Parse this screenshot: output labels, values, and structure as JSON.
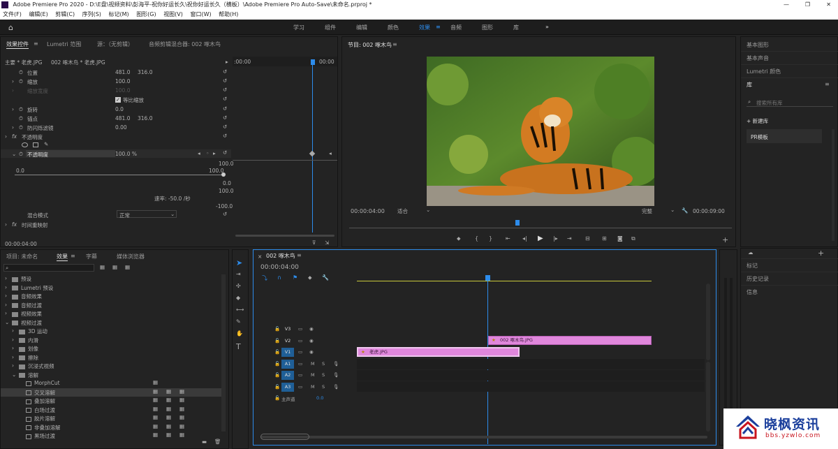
{
  "window": {
    "title": "Adobe Premiere Pro 2020 - D:\\E盘\\视频资料\\彭海平-祝你好运长久\\祝你好运长久（横板）\\Adobe Premiere Pro Auto-Save\\未命名.prproj *"
  },
  "menu": [
    "文件(F)",
    "编辑(E)",
    "剪辑(C)",
    "序列(S)",
    "标记(M)",
    "图形(G)",
    "视图(V)",
    "窗口(W)",
    "帮助(H)"
  ],
  "workspaces": [
    "学习",
    "组件",
    "编辑",
    "颜色",
    "效果",
    "音频",
    "图形",
    "库"
  ],
  "workspace_active": "效果",
  "effect_controls": {
    "tabs": [
      "效果控件",
      "Lumetri 范围",
      "源：（无剪辑）",
      "音频剪辑混合器: 002 啄木鸟"
    ],
    "clip_path": "主要 * 老虎.JPG",
    "clip_link": "002 啄木鸟 * 老虎.JPG",
    "timecode_start": ":00:00",
    "timecode_end": "00:00",
    "properties": [
      {
        "label": "位置",
        "v1": "481.0",
        "v2": "316.0"
      },
      {
        "label": "缩放",
        "v1": "100.0",
        "v2": ""
      },
      {
        "label": "缩放宽度",
        "v1": "100.0",
        "v2": ""
      },
      {
        "label": "等比缩放",
        "v1": "",
        "v2": ""
      },
      {
        "label": "旋转",
        "v1": "0.0",
        "v2": ""
      },
      {
        "label": "锚点",
        "v1": "481.0",
        "v2": "316.0"
      },
      {
        "label": "防闪烁滤镜",
        "v1": "0.00",
        "v2": ""
      }
    ],
    "opacity_section": "不透明度",
    "opacity_label": "不透明度",
    "opacity_value": "100.0 %",
    "graph_min": "0.0",
    "graph_max": "100.0",
    "graph_labels": [
      "100.0",
      "0.0",
      "100.0",
      "-100.0"
    ],
    "rate": "速率: -50.0 /秒",
    "blend_label": "混合模式",
    "blend_value": "正常",
    "time_remap": "时间重映射",
    "footer_time": "00:00:04:00"
  },
  "program_monitor": {
    "title": "节目: 002 啄木鸟",
    "timecode": "00:00:04:00",
    "fit": "适合",
    "quality": "完整",
    "duration": "00:00:09:00"
  },
  "project_panel": {
    "tabs": [
      "项目: 未命名",
      "效果",
      "字幕",
      "媒体浏览器"
    ],
    "tree": [
      {
        "label": "预设",
        "indent": 0,
        "type": "folder"
      },
      {
        "label": "Lumetri 预设",
        "indent": 0,
        "type": "folder"
      },
      {
        "label": "音频效果",
        "indent": 0,
        "type": "folder"
      },
      {
        "label": "音频过渡",
        "indent": 0,
        "type": "folder"
      },
      {
        "label": "视频效果",
        "indent": 0,
        "type": "folder"
      },
      {
        "label": "视频过渡",
        "indent": 0,
        "type": "folder"
      },
      {
        "label": "3D 运动",
        "indent": 1,
        "type": "folder"
      },
      {
        "label": "内滑",
        "indent": 1,
        "type": "folder"
      },
      {
        "label": "划像",
        "indent": 1,
        "type": "folder"
      },
      {
        "label": "擦除",
        "indent": 1,
        "type": "folder"
      },
      {
        "label": "沉浸式视频",
        "indent": 1,
        "type": "folder"
      },
      {
        "label": "溶解",
        "indent": 1,
        "type": "folder"
      },
      {
        "label": "MorphCut",
        "indent": 2,
        "type": "effect"
      },
      {
        "label": "交叉溶解",
        "indent": 2,
        "type": "effect"
      },
      {
        "label": "叠加溶解",
        "indent": 2,
        "type": "effect"
      },
      {
        "label": "白场过渡",
        "indent": 2,
        "type": "effect"
      },
      {
        "label": "胶片溶解",
        "indent": 2,
        "type": "effect"
      },
      {
        "label": "非叠加溶解",
        "indent": 2,
        "type": "effect"
      },
      {
        "label": "黑场过渡",
        "indent": 2,
        "type": "effect"
      }
    ]
  },
  "timeline": {
    "tab": "002 啄木鸟",
    "timecode": "00:00:04:00",
    "tracks": [
      "V3",
      "V2",
      "V1",
      "A1",
      "A2",
      "A3"
    ],
    "master": "主声道",
    "master_value": "0.0",
    "clip_v2": "002 啄木鸟.JPG",
    "clip_v1": "老虎.JPG"
  },
  "right_panel": {
    "items_top": [
      "基本图形",
      "基本声音",
      "Lumetri 颜色"
    ],
    "library_title": "库",
    "search_placeholder": "搜索所有库",
    "new_library": "新建库",
    "library_item": "PR模板",
    "items_bottom": [
      "标记",
      "历史记录",
      "信息"
    ]
  },
  "watermark": {
    "cn": "晓枫资讯",
    "url": "bbs.yzwlo.com"
  },
  "colors": {
    "accent": "#2d8ceb",
    "clip": "#e087dc",
    "yellow_bar": "#c8c83c"
  }
}
